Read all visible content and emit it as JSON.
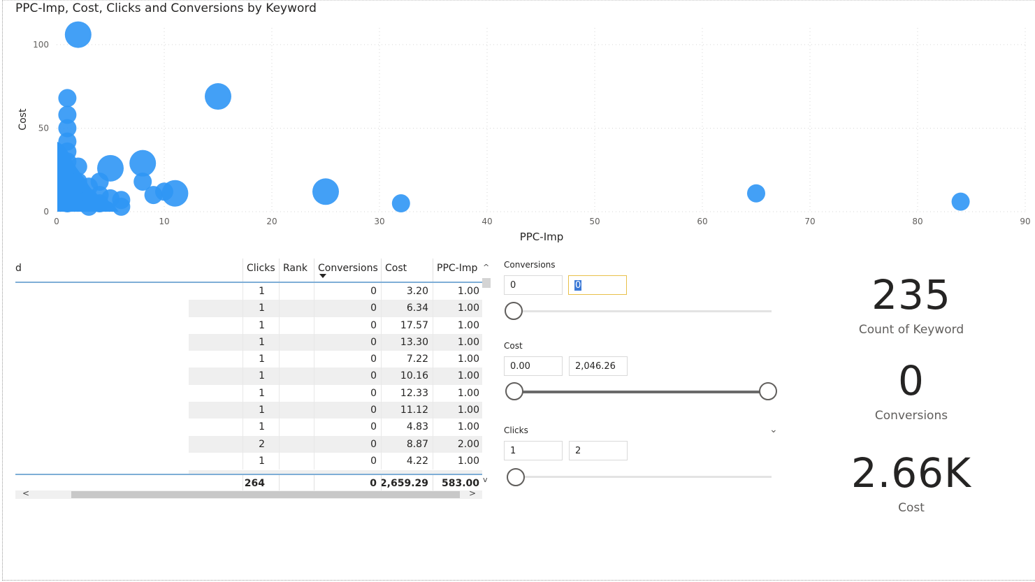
{
  "chart": {
    "title": "PPC-Imp, Cost, Clicks and Conversions by Keyword",
    "accent": "#2f96f5"
  },
  "chart_data": {
    "type": "scatter",
    "title": "PPC-Imp, Cost, Clicks and Conversions by Keyword",
    "xlabel": "PPC-Imp",
    "ylabel": "Cost",
    "xlim": [
      0,
      90
    ],
    "ylim": [
      0,
      110
    ],
    "x_ticks": [
      "0",
      "10",
      "20",
      "30",
      "40",
      "50",
      "60",
      "70",
      "80",
      "90"
    ],
    "y_ticks": [
      "0",
      "50",
      "100"
    ],
    "grid": true,
    "points": [
      {
        "x": 2,
        "y": 106,
        "size": 2
      },
      {
        "x": 15,
        "y": 69,
        "size": 2
      },
      {
        "x": 1,
        "y": 68,
        "size": 1
      },
      {
        "x": 1,
        "y": 58,
        "size": 1
      },
      {
        "x": 1,
        "y": 50,
        "size": 1
      },
      {
        "x": 1,
        "y": 42,
        "size": 1
      },
      {
        "x": 1,
        "y": 36,
        "size": 1
      },
      {
        "x": 1,
        "y": 30,
        "size": 1
      },
      {
        "x": 1,
        "y": 25,
        "size": 1
      },
      {
        "x": 1,
        "y": 20,
        "size": 1
      },
      {
        "x": 1,
        "y": 15,
        "size": 1
      },
      {
        "x": 1,
        "y": 10,
        "size": 1
      },
      {
        "x": 1,
        "y": 5,
        "size": 1
      },
      {
        "x": 2,
        "y": 27,
        "size": 1
      },
      {
        "x": 2,
        "y": 18,
        "size": 1
      },
      {
        "x": 2,
        "y": 12,
        "size": 1
      },
      {
        "x": 2,
        "y": 6,
        "size": 1
      },
      {
        "x": 3,
        "y": 15,
        "size": 1
      },
      {
        "x": 3,
        "y": 8,
        "size": 1
      },
      {
        "x": 3,
        "y": 3,
        "size": 1
      },
      {
        "x": 4,
        "y": 18,
        "size": 1
      },
      {
        "x": 4,
        "y": 10,
        "size": 1
      },
      {
        "x": 4,
        "y": 5,
        "size": 1
      },
      {
        "x": 5,
        "y": 26,
        "size": 2
      },
      {
        "x": 5,
        "y": 8,
        "size": 1
      },
      {
        "x": 6,
        "y": 7,
        "size": 1
      },
      {
        "x": 6,
        "y": 3,
        "size": 1
      },
      {
        "x": 8,
        "y": 29,
        "size": 2
      },
      {
        "x": 8,
        "y": 18,
        "size": 1
      },
      {
        "x": 9,
        "y": 10,
        "size": 1
      },
      {
        "x": 10,
        "y": 12,
        "size": 1
      },
      {
        "x": 11,
        "y": 11,
        "size": 2
      },
      {
        "x": 25,
        "y": 12,
        "size": 2
      },
      {
        "x": 32,
        "y": 5,
        "size": 1
      },
      {
        "x": 65,
        "y": 11,
        "size": 1
      },
      {
        "x": 84,
        "y": 6,
        "size": 1
      }
    ]
  },
  "table": {
    "columns": {
      "keyword_partial": "d",
      "clicks": "Clicks",
      "rank": "Rank",
      "conversions": "Conversions",
      "cost": "Cost",
      "ppc_imp": "PPC-Imp"
    },
    "rows": [
      {
        "clicks": "1",
        "conversions": "0",
        "cost": "3.20",
        "ppc_imp": "1.00"
      },
      {
        "clicks": "1",
        "conversions": "0",
        "cost": "6.34",
        "ppc_imp": "1.00"
      },
      {
        "clicks": "1",
        "conversions": "0",
        "cost": "17.57",
        "ppc_imp": "1.00"
      },
      {
        "clicks": "1",
        "conversions": "0",
        "cost": "13.30",
        "ppc_imp": "1.00"
      },
      {
        "clicks": "1",
        "conversions": "0",
        "cost": "7.22",
        "ppc_imp": "1.00"
      },
      {
        "clicks": "1",
        "conversions": "0",
        "cost": "10.16",
        "ppc_imp": "1.00"
      },
      {
        "clicks": "1",
        "conversions": "0",
        "cost": "12.33",
        "ppc_imp": "1.00"
      },
      {
        "clicks": "1",
        "conversions": "0",
        "cost": "11.12",
        "ppc_imp": "1.00"
      },
      {
        "clicks": "1",
        "conversions": "0",
        "cost": "4.83",
        "ppc_imp": "1.00"
      },
      {
        "clicks": "2",
        "conversions": "0",
        "cost": "8.87",
        "ppc_imp": "2.00"
      },
      {
        "clicks": "1",
        "conversions": "0",
        "cost": "4.22",
        "ppc_imp": "1.00"
      }
    ],
    "totals": {
      "clicks": "264",
      "conversions": "0",
      "cost": "2,659.29",
      "ppc_imp": "583.00"
    }
  },
  "slicers": {
    "conversions": {
      "title": "Conversions",
      "min": "0",
      "max": "0",
      "min_pos": 0,
      "max_pos": 0
    },
    "cost": {
      "title": "Cost",
      "min": "0.00",
      "max": "2,046.26",
      "min_pos": 0,
      "max_pos": 1
    },
    "clicks": {
      "title": "Clicks",
      "min": "1",
      "max": "2",
      "min_pos": 0,
      "max_pos": 0
    }
  },
  "cards": [
    {
      "value": "235",
      "label": "Count of Keyword"
    },
    {
      "value": "0",
      "label": "Conversions"
    },
    {
      "value": "2.66K",
      "label": "Cost"
    }
  ]
}
